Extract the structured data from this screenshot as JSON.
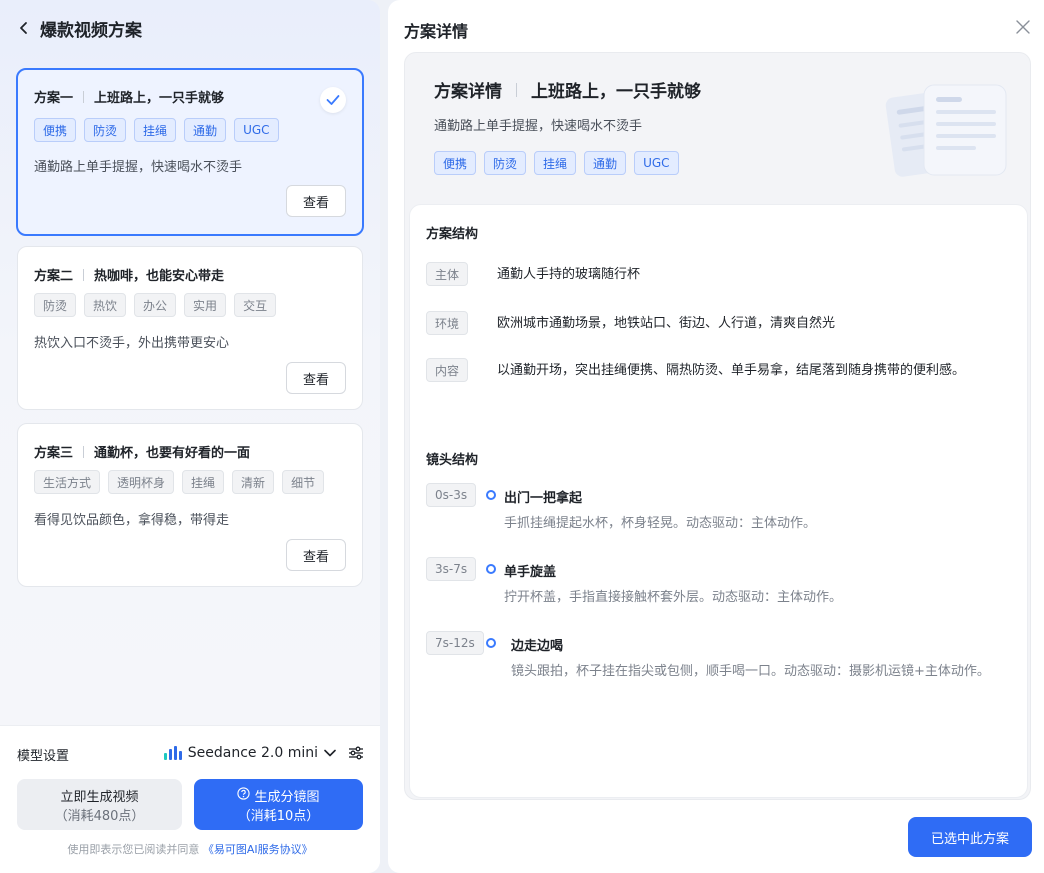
{
  "left": {
    "title": "爆款视频方案",
    "plans": [
      {
        "index_label": "方案一",
        "title": "上班路上，一只手就够",
        "tags": [
          "便携",
          "防烫",
          "挂绳",
          "通勤",
          "UGC"
        ],
        "desc": "通勤路上单手提握，快速喝水不烫手",
        "view_label": "查看",
        "selected": true
      },
      {
        "index_label": "方案二",
        "title": "热咖啡，也能安心带走",
        "tags": [
          "防烫",
          "热饮",
          "办公",
          "实用",
          "交互"
        ],
        "desc": "热饮入口不烫手，外出携带更安心",
        "view_label": "查看",
        "selected": false
      },
      {
        "index_label": "方案三",
        "title": "通勤杯，也要有好看的一面",
        "tags": [
          "生活方式",
          "透明杯身",
          "挂绳",
          "清新",
          "细节"
        ],
        "desc": "看得见饮品颜色，拿得稳，带得走",
        "view_label": "查看",
        "selected": false
      }
    ]
  },
  "settings": {
    "label": "模型设置",
    "model": "Seedance 2.0 mini",
    "gen_video": {
      "label": "立即生成视频",
      "cost": "（消耗480点）"
    },
    "gen_board": {
      "label": "生成分镜图",
      "cost": "（消耗10点）"
    },
    "agree_prefix": "使用即表示您已阅读并同意",
    "agree_link": "《易可图AI服务协议》"
  },
  "detail": {
    "panel_title": "方案详情",
    "head_label": "方案详情",
    "head_title": "上班路上，一只手就够",
    "sub": "通勤路上单手提握，快速喝水不烫手",
    "tags": [
      "便携",
      "防烫",
      "挂绳",
      "通勤",
      "UGC"
    ],
    "structure_title": "方案结构",
    "structure": [
      {
        "label": "主体",
        "value": "通勤人手持的玻璃随行杯"
      },
      {
        "label": "环境",
        "value": "欧洲城市通勤场景，地铁站口、街边、人行道，清爽自然光"
      },
      {
        "label": "内容",
        "value": "以通勤开场，突出挂绳便携、隔热防烫、单手易拿，结尾落到随身携带的便利感。"
      }
    ],
    "shots_title": "镜头结构",
    "shots": [
      {
        "time": "0s-3s",
        "title": "出门一把拿起",
        "desc": "手抓挂绳提起水杯，杯身轻晃。动态驱动：主体动作。"
      },
      {
        "time": "3s-7s",
        "title": "单手旋盖",
        "desc": "拧开杯盖，手指直接接触杯套外层。动态驱动：主体动作。"
      },
      {
        "time": "7s-12s",
        "title": "边走边喝",
        "desc": "镜头跟拍，杯子挂在指尖或包侧，顺手喝一口。动态驱动：摄影机运镜+主体动作。"
      }
    ],
    "confirm_label": "已选中此方案"
  },
  "colors": {
    "accent": "#2f6cf5",
    "tag_blue_bg": "#e3ecff",
    "tag_blue_text": "#2f6be8"
  }
}
